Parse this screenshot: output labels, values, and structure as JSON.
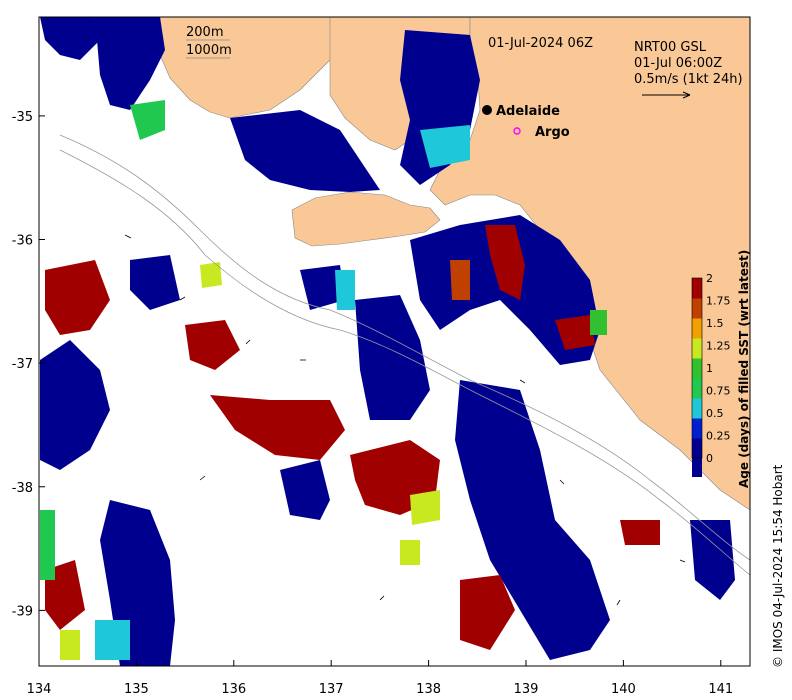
{
  "map": {
    "timestamp": "01-Jul-2024 06Z",
    "product_line1": "NRT00 GSL",
    "product_line2": "01-Jul 06:00Z",
    "scale_label": "0.5m/s (1kt 24h)",
    "contour_label_1": "200m",
    "contour_label_2": "1000m",
    "place_adelaide": "Adelaide",
    "place_argo": "Argo",
    "credit": "© IMOS 04-Jul-2024 15:54 Hobart",
    "colorbar_title": "Age (days) of filled SST (wrt latest)",
    "x_ticks": [
      "134",
      "135",
      "136",
      "137",
      "138",
      "139",
      "140",
      "141"
    ],
    "y_ticks": [
      "-35",
      "-36",
      "-37",
      "-38",
      "-39"
    ],
    "colorbar_ticks": [
      "2",
      "1.75",
      "1.5",
      "1.25",
      "1",
      "0.75",
      "0.5",
      "0.25",
      "0"
    ],
    "colors": {
      "land": "#f9c896",
      "age_0": "#00008f",
      "age_025": "#0020d0",
      "age_05": "#1ec8d8",
      "age_075": "#20c850",
      "age_1": "#30c030",
      "age_125": "#c8e820",
      "age_15": "#f0a000",
      "age_175": "#c04000",
      "age_2": "#a00000",
      "argo": "#ff00ff"
    },
    "lon_range": [
      134,
      141.3
    ],
    "lat_range": [
      -39.45,
      -34.2
    ]
  }
}
